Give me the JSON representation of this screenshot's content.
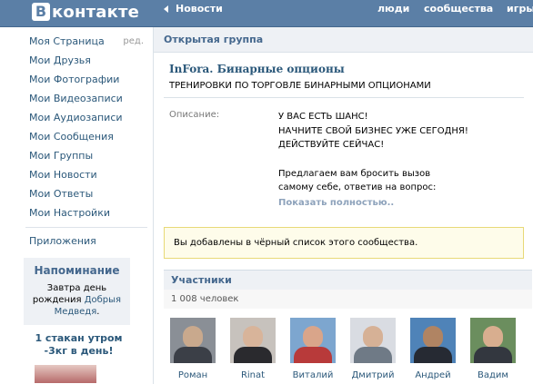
{
  "header": {
    "logo_letter": "В",
    "logo_text": "контакте",
    "news": "Новости",
    "links": [
      "люди",
      "сообщества",
      "игры"
    ]
  },
  "sidebar": {
    "items": [
      "Моя Страница",
      "Мои Друзья",
      "Мои Фотографии",
      "Мои Видеозаписи",
      "Мои Аудиозаписи",
      "Мои Сообщения",
      "Мои Группы",
      "Мои Новости",
      "Мои Ответы",
      "Мои Настройки"
    ],
    "edit": "ред.",
    "apps": "Приложения"
  },
  "reminder": {
    "title": "Напоминание",
    "text_before": "Завтра ",
    "bold_text": "день рождения",
    "text_mid": " ",
    "link": "Добрыя Медведя",
    "text_after": "."
  },
  "ad": {
    "title": "1 стакан утром -3кг в день!"
  },
  "group": {
    "type": "Открытая группа",
    "name": "InFora. Бинарные опционы",
    "status": "ТРЕНИРОВКИ ПО ТОРГОВЛЕ БИНАРНЫМИ ОПЦИОНАМИ",
    "desc_label": "Описание:",
    "desc_lines": [
      "У ВАС ЕСТЬ ШАНС!",
      "НАЧНИТЕ СВОЙ БИЗНЕС УЖЕ СЕГОДНЯ!",
      "ДЕЙСТВУЙТЕ СЕЙЧАС!"
    ],
    "desc_lines2": [
      "Предлагаем вам бросить вызов самому себе, ответив на вопрос:"
    ],
    "show_more": "Показать полностью.."
  },
  "notice": "Вы добавлены в чёрный список этого сообщества.",
  "members": {
    "title": "Участники",
    "count": "1 008 человек",
    "list": [
      "Роман",
      "Rinat",
      "Виталий",
      "Дмитрий",
      "Андрей",
      "Вадим"
    ]
  },
  "colors": {
    "header": "#5b7fa6",
    "link": "#2b587a",
    "panel": "#eef1f5"
  }
}
